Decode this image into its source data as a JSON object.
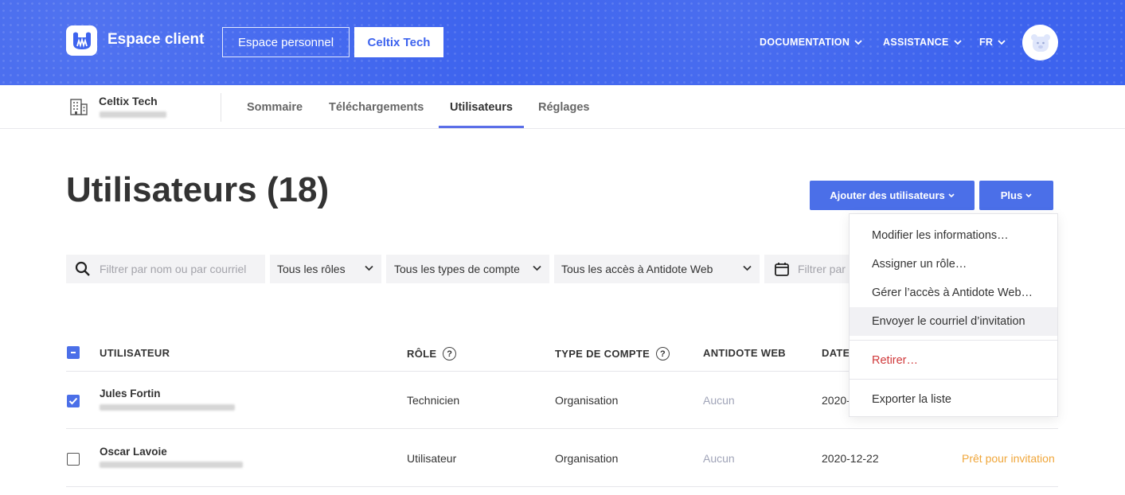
{
  "header": {
    "app_title": "Espace client",
    "personal_space_button": "Espace personnel",
    "org_button": "Celtix Tech",
    "nav": [
      {
        "label": "DOCUMENTATION"
      },
      {
        "label": "ASSISTANCE"
      },
      {
        "label": "FR"
      }
    ]
  },
  "subnav": {
    "org_name": "Celtix Tech",
    "tabs": [
      {
        "label": "Sommaire"
      },
      {
        "label": "Téléchargements"
      },
      {
        "label": "Utilisateurs"
      },
      {
        "label": "Réglages"
      }
    ],
    "active_tab": "Utilisateurs"
  },
  "page": {
    "title": "Utilisateurs (18)",
    "add_users_button": "Ajouter des utilisateurs",
    "more_button": "Plus"
  },
  "filters": {
    "search_placeholder": "Filtrer par nom ou par courriel",
    "roles": "Tous les rôles",
    "account_types": "Tous les types de compte",
    "web_access": "Tous les accès à Antidote Web",
    "date_placeholder": "Filtrer par"
  },
  "table": {
    "headers": {
      "user": "UTILISATEUR",
      "role": "RÔLE",
      "account_type": "TYPE DE COMPTE",
      "antidote_web": "ANTIDOTE WEB",
      "date": "DATE"
    },
    "rows": [
      {
        "name": "Jules Fortin",
        "role": "Technicien",
        "account_type": "Organisation",
        "antidote_web": "Aucun",
        "date": "2020-",
        "status": "",
        "checked": true
      },
      {
        "name": "Oscar Lavoie",
        "role": "Utilisateur",
        "account_type": "Organisation",
        "antidote_web": "Aucun",
        "date": "2020-12-22",
        "status": "Prêt pour invitation",
        "checked": false
      }
    ]
  },
  "menu": {
    "items": [
      {
        "label": "Modifier les informations…"
      },
      {
        "label": "Assigner un rôle…"
      },
      {
        "label": "Gérer l’accès à Antidote Web…"
      },
      {
        "label": "Envoyer le courriel d’invitation"
      },
      {
        "label": "Retirer…"
      },
      {
        "label": "Exporter la liste"
      }
    ]
  },
  "colors": {
    "header_blue": "#3d63ee",
    "primary": "#4b6fe8",
    "danger": "#d0393b",
    "warning": "#f0a63a"
  }
}
